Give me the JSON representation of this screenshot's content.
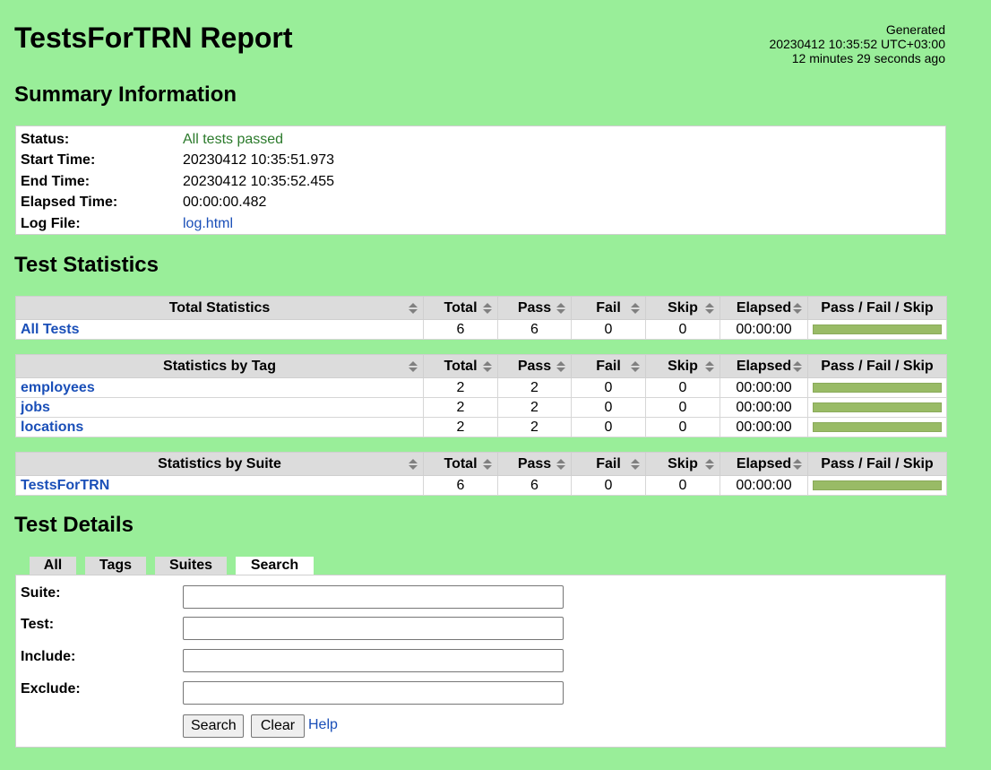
{
  "header": {
    "title": "TestsForTRN Report",
    "generated_label": "Generated",
    "generated_time": "20230412 10:35:52 UTC+03:00",
    "generated_ago": "12 minutes 29 seconds ago"
  },
  "summary": {
    "heading": "Summary Information",
    "rows": [
      {
        "label": "Status:",
        "value": "All tests passed"
      },
      {
        "label": "Start Time:",
        "value": "20230412 10:35:51.973"
      },
      {
        "label": "End Time:",
        "value": "20230412 10:35:52.455"
      },
      {
        "label": "Elapsed Time:",
        "value": "00:00:00.482"
      },
      {
        "label": "Log File:",
        "value": "log.html"
      }
    ]
  },
  "statistics": {
    "heading": "Test Statistics",
    "columns": [
      "Total",
      "Pass",
      "Fail",
      "Skip",
      "Elapsed",
      "Pass / Fail / Skip"
    ],
    "total": {
      "title": "Total Statistics",
      "rows": [
        {
          "name": "All Tests",
          "total": "6",
          "pass": "6",
          "fail": "0",
          "skip": "0",
          "elapsed": "00:00:00",
          "pass_fraction": 1.0
        }
      ]
    },
    "tag": {
      "title": "Statistics by Tag",
      "rows": [
        {
          "name": "employees",
          "total": "2",
          "pass": "2",
          "fail": "0",
          "skip": "0",
          "elapsed": "00:00:00",
          "pass_fraction": 1.0
        },
        {
          "name": "jobs",
          "total": "2",
          "pass": "2",
          "fail": "0",
          "skip": "0",
          "elapsed": "00:00:00",
          "pass_fraction": 1.0
        },
        {
          "name": "locations",
          "total": "2",
          "pass": "2",
          "fail": "0",
          "skip": "0",
          "elapsed": "00:00:00",
          "pass_fraction": 1.0
        }
      ]
    },
    "suite": {
      "title": "Statistics by Suite",
      "rows": [
        {
          "name": "TestsForTRN",
          "total": "6",
          "pass": "6",
          "fail": "0",
          "skip": "0",
          "elapsed": "00:00:00",
          "pass_fraction": 1.0
        }
      ]
    }
  },
  "details": {
    "heading": "Test Details",
    "tabs": [
      {
        "label": "All",
        "active": false
      },
      {
        "label": "Tags",
        "active": false
      },
      {
        "label": "Suites",
        "active": false
      },
      {
        "label": "Search",
        "active": true
      }
    ],
    "search": {
      "suite_label": "Suite:",
      "suite_value": "",
      "test_label": "Test:",
      "test_value": "",
      "include_label": "Include:",
      "include_value": "",
      "exclude_label": "Exclude:",
      "exclude_value": "",
      "search_button": "Search",
      "clear_button": "Clear",
      "help_link": "Help"
    }
  },
  "colors": {
    "background": "#99ee99",
    "pass_bar": "#99bb66",
    "pass_text": "#2b7a2b",
    "link": "#1a4fb8"
  }
}
